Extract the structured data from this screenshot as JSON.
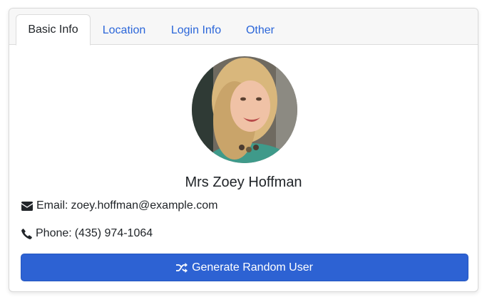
{
  "tabs": [
    {
      "label": "Basic Info",
      "active": true
    },
    {
      "label": "Location",
      "active": false
    },
    {
      "label": "Login Info",
      "active": false
    },
    {
      "label": "Other",
      "active": false
    }
  ],
  "profile": {
    "name": "Mrs Zoey Hoffman",
    "email_label": "Email:",
    "email": "zoey.hoffman@example.com",
    "phone_label": "Phone:",
    "phone": "(435) 974-1064"
  },
  "button": {
    "label": "Generate Random User",
    "icon": "shuffle-icon"
  },
  "icons": {
    "email": "envelope-icon",
    "phone": "phone-icon"
  },
  "colors": {
    "accent": "#2d62d3",
    "tab_link": "#2b66d9",
    "text": "#212529"
  }
}
